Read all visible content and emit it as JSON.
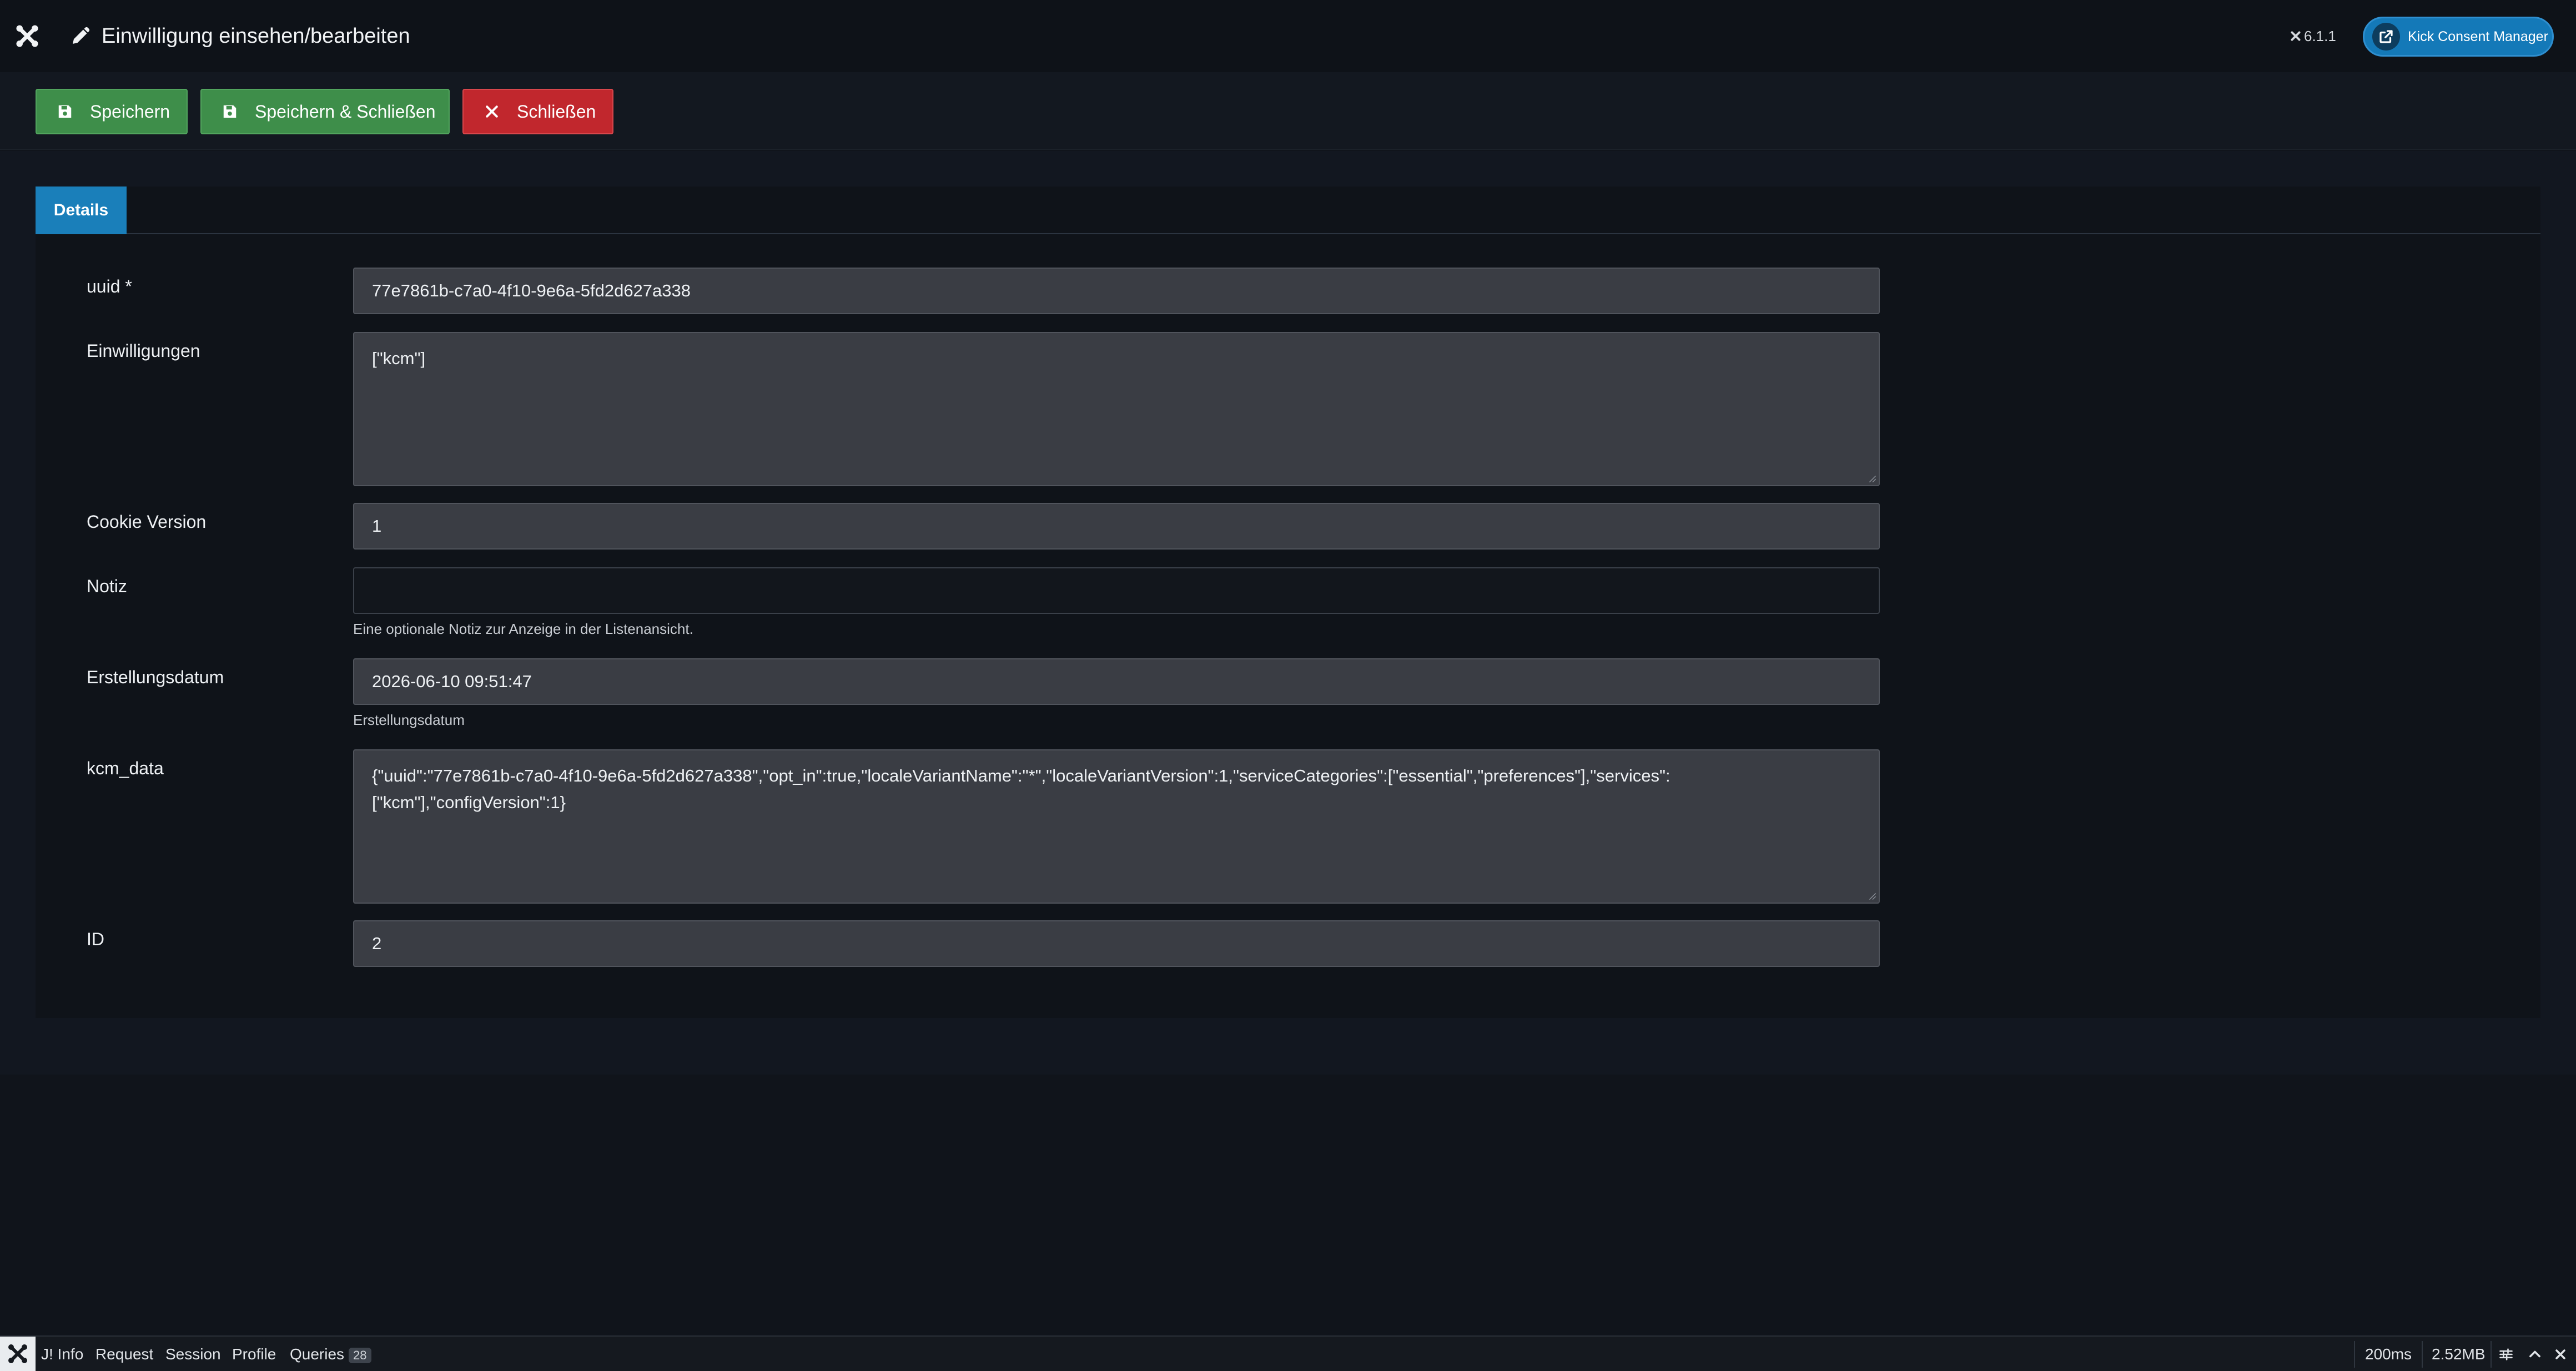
{
  "header": {
    "title": "Einwilligung einsehen/bearbeiten",
    "version": "6.1.1",
    "external_button": "Kick Consent Manager",
    "colors": {
      "accent": "#1479b8"
    }
  },
  "toolbar": {
    "save_label": "Speichern",
    "save_close_label": "Speichern & Schließen",
    "close_label": "Schließen",
    "colors": {
      "save": "#3e8e4a",
      "close": "#c1272d"
    }
  },
  "tabs": [
    {
      "label": "Details",
      "active": true
    }
  ],
  "form": {
    "uuid": {
      "label": "uuid *",
      "value": "77e7861b-c7a0-4f10-9e6a-5fd2d627a338"
    },
    "consents": {
      "label": "Einwilligungen",
      "value": "[\"kcm\"]"
    },
    "cookie_version": {
      "label": "Cookie Version",
      "value": "1"
    },
    "note": {
      "label": "Notiz",
      "value": "",
      "hint": "Eine optionale Notiz zur Anzeige in der Listenansicht."
    },
    "created": {
      "label": "Erstellungsdatum",
      "value": "2026-06-10 09:51:47",
      "hint": "Erstellungsdatum"
    },
    "kcm_data": {
      "label": "kcm_data",
      "line1": "{\"uuid\":\"77e7861b-c7a0-4f10-9e6a-5fd2d627a338\",\"opt_in\":true,\"localeVariantName\":\"*\",\"localeVariantVersion\":1,\"serviceCategories\":[\"essential\",\"preferences\"],\"services\":",
      "line2": "[\"kcm\"],\"configVersion\":1}"
    },
    "id": {
      "label": "ID",
      "value": "2"
    }
  },
  "debugbar": {
    "tabs": [
      "J! Info",
      "Request",
      "Session",
      "Profile",
      "Queries"
    ],
    "queries_count": "28",
    "time": "200ms",
    "memory": "2.52MB"
  }
}
